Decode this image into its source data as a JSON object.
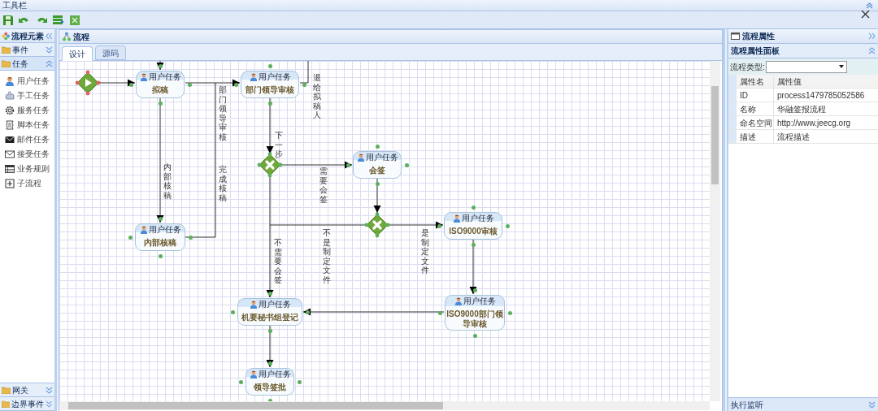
{
  "top_bar": {
    "title": "工具栏"
  },
  "palette": {
    "title": "流程元素",
    "sections": [
      {
        "label": "事件",
        "expanded": false
      },
      {
        "label": "任务",
        "expanded": true,
        "items": [
          {
            "label": "用户任务",
            "kind": "user"
          },
          {
            "label": "手工任务",
            "kind": "manual"
          },
          {
            "label": "服务任务",
            "kind": "service"
          },
          {
            "label": "脚本任务",
            "kind": "script"
          },
          {
            "label": "邮件任务",
            "kind": "mail"
          },
          {
            "label": "接受任务",
            "kind": "receive"
          },
          {
            "label": "业务规则",
            "kind": "rule"
          },
          {
            "label": "子流程",
            "kind": "subprocess"
          }
        ]
      },
      {
        "label": "网关",
        "expanded": false
      },
      {
        "label": "边界事件",
        "expanded": false
      }
    ]
  },
  "process_panel": {
    "title": "流程",
    "tabs": [
      {
        "label": "设计",
        "selected": true
      },
      {
        "label": "源码",
        "selected": false
      }
    ]
  },
  "diagram": {
    "nodes": [
      {
        "kind": "start"
      },
      {
        "kind": "task",
        "type_label": "用户任务",
        "name": "拟稿"
      },
      {
        "kind": "task",
        "type_label": "用户任务",
        "name": "部门领导审核"
      },
      {
        "kind": "gateway"
      },
      {
        "kind": "task",
        "type_label": "用户任务",
        "name": "会签"
      },
      {
        "kind": "task",
        "type_label": "用户任务",
        "name": "内部核稿"
      },
      {
        "kind": "gateway"
      },
      {
        "kind": "task",
        "type_label": "用户任务",
        "name": "ISO9000审核"
      },
      {
        "kind": "task",
        "type_label": "用户任务",
        "name": "机要秘书组登记"
      },
      {
        "kind": "task",
        "type_label": "用户任务",
        "name": "ISO9000部门领导审核"
      },
      {
        "kind": "task",
        "type_label": "用户任务",
        "name": "领导签批"
      }
    ],
    "flow_labels": [
      "部门领导审核",
      "完成核稿",
      "退给拟稿人",
      "内部核稿",
      "下一步",
      "需要会签",
      "不需要会签",
      "不是制定文件",
      "是制定文件"
    ]
  },
  "properties": {
    "title": "流程属性",
    "panel_title": "流程属性面板",
    "type_field": {
      "label": "流程类型:"
    },
    "table": {
      "columns": [
        "属性名",
        "属性值"
      ],
      "rows": [
        [
          "ID",
          "process1479785052586"
        ],
        [
          "名称",
          "华融签报流程"
        ],
        [
          "命名空间",
          "http://www.jeecg.org"
        ],
        [
          "描述",
          "流程描述"
        ]
      ]
    },
    "footer": "执行监听"
  }
}
